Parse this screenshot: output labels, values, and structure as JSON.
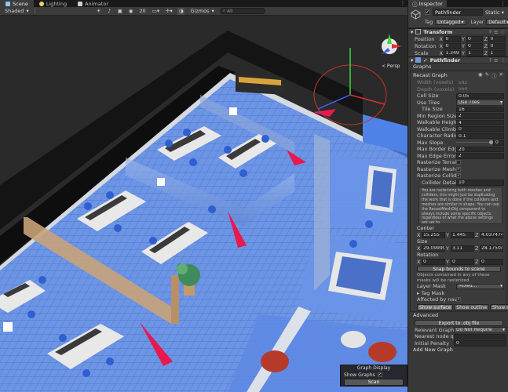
{
  "scene": {
    "tabs": [
      {
        "label": "Scene",
        "icon": "scene-icon",
        "color": "#8ec7f0"
      },
      {
        "label": "Lighting",
        "icon": "light-bulb-icon",
        "color": "#e8d36a"
      },
      {
        "label": "Animator",
        "icon": "animator-icon",
        "color": "#cfcfcf"
      }
    ],
    "toolbar": {
      "shading": "Shaded",
      "mode_2d": "2D",
      "layers_count": "20",
      "gizmos": "Gizmos",
      "search_placeholder": "All"
    },
    "persp": "< Persp",
    "graph_display": {
      "title": "Graph Display",
      "show_graphs": "Show Graphs",
      "show_graphs_checked": true,
      "scan_button": "Scan"
    },
    "colors": {
      "navmesh": "#4f82e6",
      "floor": "#cdd3dc",
      "wall": "#c8a27a",
      "arrow": "#e8194f",
      "void": "#282828"
    }
  },
  "inspector": {
    "tab": "Inspector",
    "object": {
      "name": "Pathfinder",
      "active": true,
      "static_label": "Static",
      "tag_label": "Tag",
      "tag_value": "Untagged",
      "layer_label": "Layer",
      "layer_value": "Default"
    },
    "transform": {
      "title": "Transform",
      "rows": [
        {
          "label": "Position",
          "x": "0",
          "y": "0",
          "z": "0"
        },
        {
          "label": "Rotation",
          "x": "0",
          "y": "0",
          "z": "0"
        },
        {
          "label": "Scale",
          "x": "1.349",
          "y": "1",
          "z": "1"
        }
      ]
    },
    "pathfinder": {
      "title": "Pathfinder",
      "graphs_label": "Graphs",
      "graph_name": "Recast Graph",
      "props": [
        {
          "label": "Width (voxels)",
          "value": "582",
          "dim": true
        },
        {
          "label": "Depth (voxels)",
          "value": "564",
          "dim": true
        },
        {
          "label": "Cell Size",
          "value": "0.05"
        },
        {
          "label": "Use Tiles",
          "value": "Use Tiles",
          "drop": true
        },
        {
          "label": "Tile Size",
          "value": "16",
          "indent": true
        },
        {
          "label": "Min Region Size",
          "value": "2"
        },
        {
          "label": "Walkable Height",
          "value": "4"
        },
        {
          "label": "Walkable Climb",
          "value": "0"
        },
        {
          "label": "Character Radius",
          "value": "0.1"
        }
      ],
      "max_slope": {
        "label": "Max Slope",
        "value": "0",
        "fraction": 1.0
      },
      "props2": [
        {
          "label": "Max Border Edge Le",
          "value": "20"
        },
        {
          "label": "Max Edge Error",
          "value": "2"
        }
      ],
      "checks": [
        {
          "label": "Rasterize Terrain",
          "checked": false
        },
        {
          "label": "Rasterize Meshes",
          "checked": true
        },
        {
          "label": "Rasterize Colliders",
          "checked": true
        }
      ],
      "collider_detail": {
        "label": "Collider Detail",
        "value": "10"
      },
      "help_text": "You are rasterizing both meshes and colliders, this might just be duplicating the work that is done if the colliders and meshes are similar in shape. You can use the RecastMeshObj component to always include some specific objects regardless of what the above settings are set to.",
      "center": {
        "label": "Center",
        "x": "15.255",
        "y": "1.445",
        "z": "4.037474"
      },
      "size": {
        "label": "Size",
        "x": "29.09999",
        "y": "3.11",
        "z": "28.17504"
      },
      "rotation": {
        "label": "Rotation",
        "x": "0",
        "y": "0",
        "z": "0"
      },
      "snap_button": "Snap bounds to scene",
      "mask_note": "Objects contained in any of these masks will be rasterized",
      "layer_mask": {
        "label": "Layer Mask",
        "value": "Mixed..."
      },
      "tag_mask": "Tag Mask",
      "affected_by_navmesh": {
        "label": "Affected by navme",
        "checked": true
      },
      "buttons": [
        "Show surface",
        "Show outline",
        "Show connec"
      ]
    },
    "advanced": {
      "title": "Advanced",
      "export_button": "Export to .obj file",
      "relevant_graph": {
        "label": "Relevant Graph Su",
        "value": "Do Not Require"
      },
      "nearest_node": {
        "label": "Nearest node quer",
        "value": ""
      },
      "initial_penalty": {
        "label": "Initial Penalty",
        "value": "0"
      },
      "add_graph": "Add New Graph"
    }
  }
}
